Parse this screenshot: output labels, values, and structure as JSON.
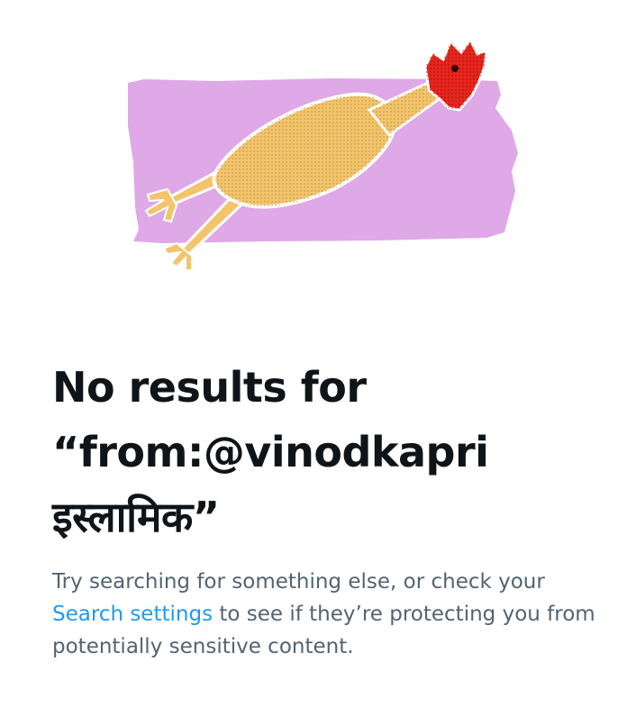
{
  "empty_state": {
    "title_line1": "No results for",
    "title_line2": "“from:@vinodkapri",
    "title_line3": "इस्लामिक”",
    "description_before": "Try searching for something else, or check your",
    "search_settings_link": "Search settings",
    "description_after": "to see if they’re protecting you from potentially sensitive content.",
    "illustration_icon": "rubber-chicken-illustration"
  },
  "colors": {
    "title": "#0f1419",
    "secondary_text": "#536471",
    "link": "#1d9bf0",
    "illustration_backdrop": "#dea9e6",
    "chicken_body": "#f2c46c",
    "chicken_head": "#e8251e"
  }
}
